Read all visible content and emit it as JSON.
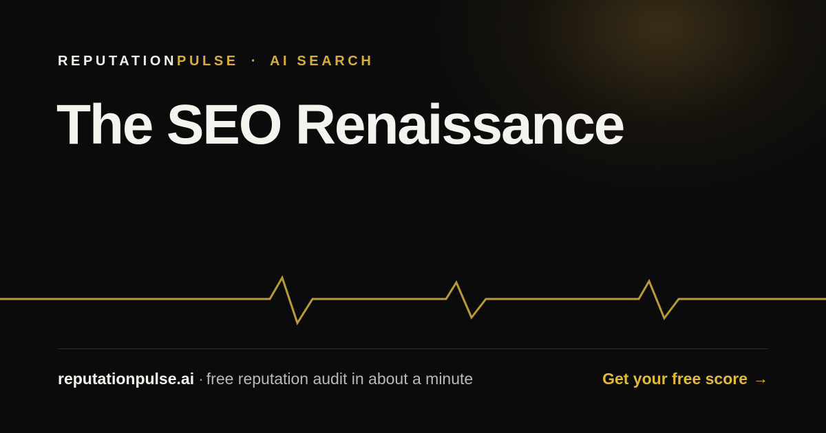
{
  "brand": {
    "name_part1": "REPUTATION",
    "name_part2": "PULSE",
    "separator": "·",
    "section": "AI SEARCH"
  },
  "title": "The SEO Renaissance",
  "footer": {
    "domain": "reputationpulse.ai",
    "separator": "·",
    "tagline": "free reputation audit in about a minute",
    "cta_label": "Get your free score",
    "cta_icon": "→"
  },
  "colors": {
    "background": "#0b0b0b",
    "accent_gold": "#d4ae45",
    "title_text": "#f5f3ee",
    "muted_text": "#b9b9b9"
  }
}
